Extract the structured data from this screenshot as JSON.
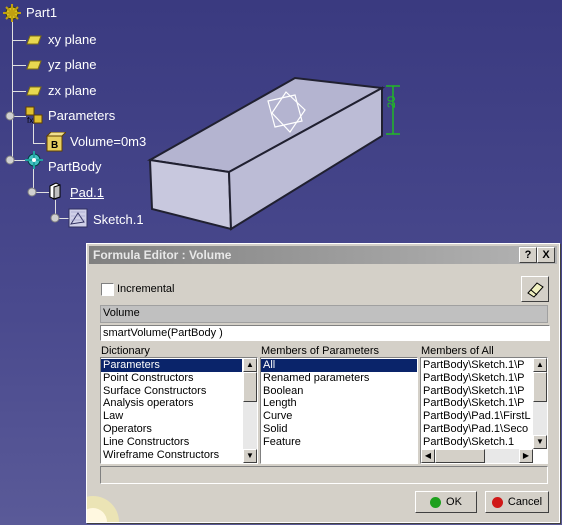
{
  "tree": {
    "root": "Part1",
    "planes": [
      "xy plane",
      "yz plane",
      "zx plane"
    ],
    "parameters": "Parameters",
    "volume_param": "Volume=0m3",
    "partbody": "PartBody",
    "pad": "Pad.1",
    "sketch": "Sketch.1"
  },
  "model": {
    "dimension_label": "20"
  },
  "dialog": {
    "title": "Formula Editor : Volume",
    "help_btn": "?",
    "close_btn": "X",
    "incremental_label": "Incremental",
    "incremental_checked": false,
    "param_name": "Volume",
    "formula": "smartVolume(PartBody )",
    "dictionary": {
      "header": "Dictionary",
      "items": [
        "Parameters",
        "Point Constructors",
        "Surface Constructors",
        "Analysis operators",
        "Law",
        "Operators",
        "Line Constructors",
        "Wireframe Constructors"
      ],
      "selected": 0
    },
    "members_of_parameters": {
      "header": "Members of Parameters",
      "items": [
        "All",
        "Renamed parameters",
        "Boolean",
        "Length",
        "Curve",
        "Solid",
        "Feature"
      ],
      "selected": 0
    },
    "members_of_all": {
      "header": "Members of All",
      "items": [
        "PartBody\\Sketch.1\\P",
        "PartBody\\Sketch.1\\P",
        "PartBody\\Sketch.1\\P",
        "PartBody\\Sketch.1\\P",
        "PartBody\\Pad.1\\FirstL",
        "PartBody\\Pad.1\\Seco",
        "PartBody\\Sketch.1"
      ]
    },
    "ok_label": "OK",
    "cancel_label": "Cancel",
    "colors": {
      "ok_dot": "#1ea01e",
      "cancel_dot": "#d01818",
      "selection": "#0a246a"
    }
  }
}
